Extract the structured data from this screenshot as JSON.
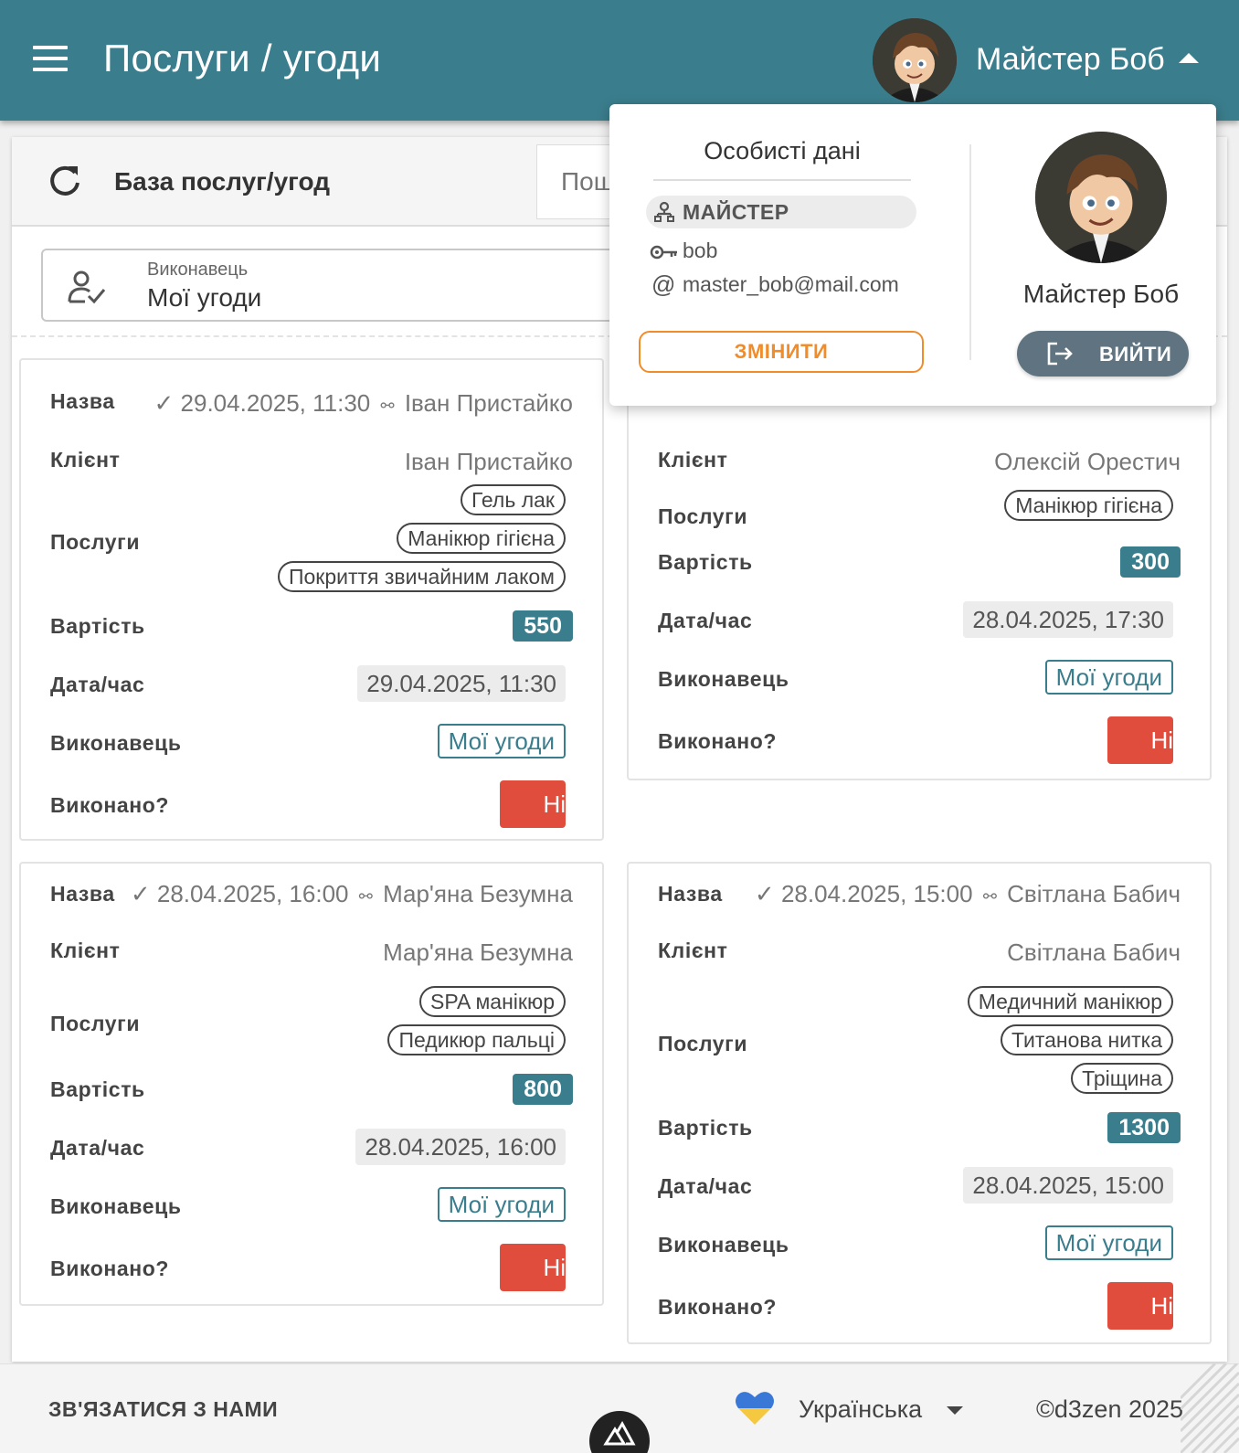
{
  "header": {
    "title": "Послуги / угоди",
    "user_name": "Майстер Боб",
    "menu_icon": "hamburger-menu-icon",
    "caret_icon": "caret-up-icon"
  },
  "toolbar": {
    "title": "База послуг/угод",
    "search_placeholder": "Пошук",
    "refresh_icon": "refresh-icon"
  },
  "filter": {
    "label": "Виконавець",
    "value": "Мої угоди",
    "icon": "user-check-icon"
  },
  "labels": {
    "title": "Назва",
    "client": "Клієнт",
    "services": "Послуги",
    "price": "Вартість",
    "datetime": "Дата/час",
    "executor": "Виконавець",
    "done": "Виконано?"
  },
  "deals": [
    {
      "check": "✓",
      "date": "29.04.2025, 11:30",
      "link_icon": "⚯",
      "client": "Іван Пристайко",
      "services": [
        "Гель лак",
        "Манікюр гігієна",
        "Покриття звичайним лаком"
      ],
      "price": "550",
      "datetime": "29.04.2025, 11:30",
      "executor": "Мої угоди",
      "done": "Ні"
    },
    {
      "client": "Олексій Орестич",
      "services": [
        "Манікюр гігієна"
      ],
      "price": "300",
      "datetime": "28.04.2025, 17:30",
      "executor": "Мої угоди",
      "done": "Ні"
    },
    {
      "check": "✓",
      "date": "28.04.2025, 16:00",
      "link_icon": "⚯",
      "client": "Мар'яна Безумна",
      "services": [
        "SPA манікюр",
        "Педикюр пальці"
      ],
      "price": "800",
      "datetime": "28.04.2025, 16:00",
      "executor": "Мої угоди",
      "done": "Ні"
    },
    {
      "check": "✓",
      "date": "28.04.2025, 15:00",
      "link_icon": "⚯",
      "client": "Світлана Бабич",
      "services": [
        "Медичний манікюр",
        "Титанова нитка",
        "Тріщина"
      ],
      "price": "1300",
      "datetime": "28.04.2025, 15:00",
      "executor": "Мої угоди",
      "done": "Ні"
    }
  ],
  "profile_menu": {
    "title": "Особисті дані",
    "role": "МАЙСТЕР",
    "login": "bob",
    "at_symbol": "@",
    "email": "master_bob@mail.com",
    "change_button": "ЗМІНИТИ",
    "name": "Майстер Боб",
    "logout_button": "ВИЙТИ"
  },
  "footer": {
    "contact": "ЗВ'ЯЗАТИСЯ З НАМИ",
    "language": "Українська",
    "copyright": "©d3zen 2025"
  },
  "colors": {
    "primary": "#3a7d8c",
    "danger": "#e14d3d",
    "accent_orange": "#f08c2a",
    "logout_gray": "#5f7480"
  }
}
